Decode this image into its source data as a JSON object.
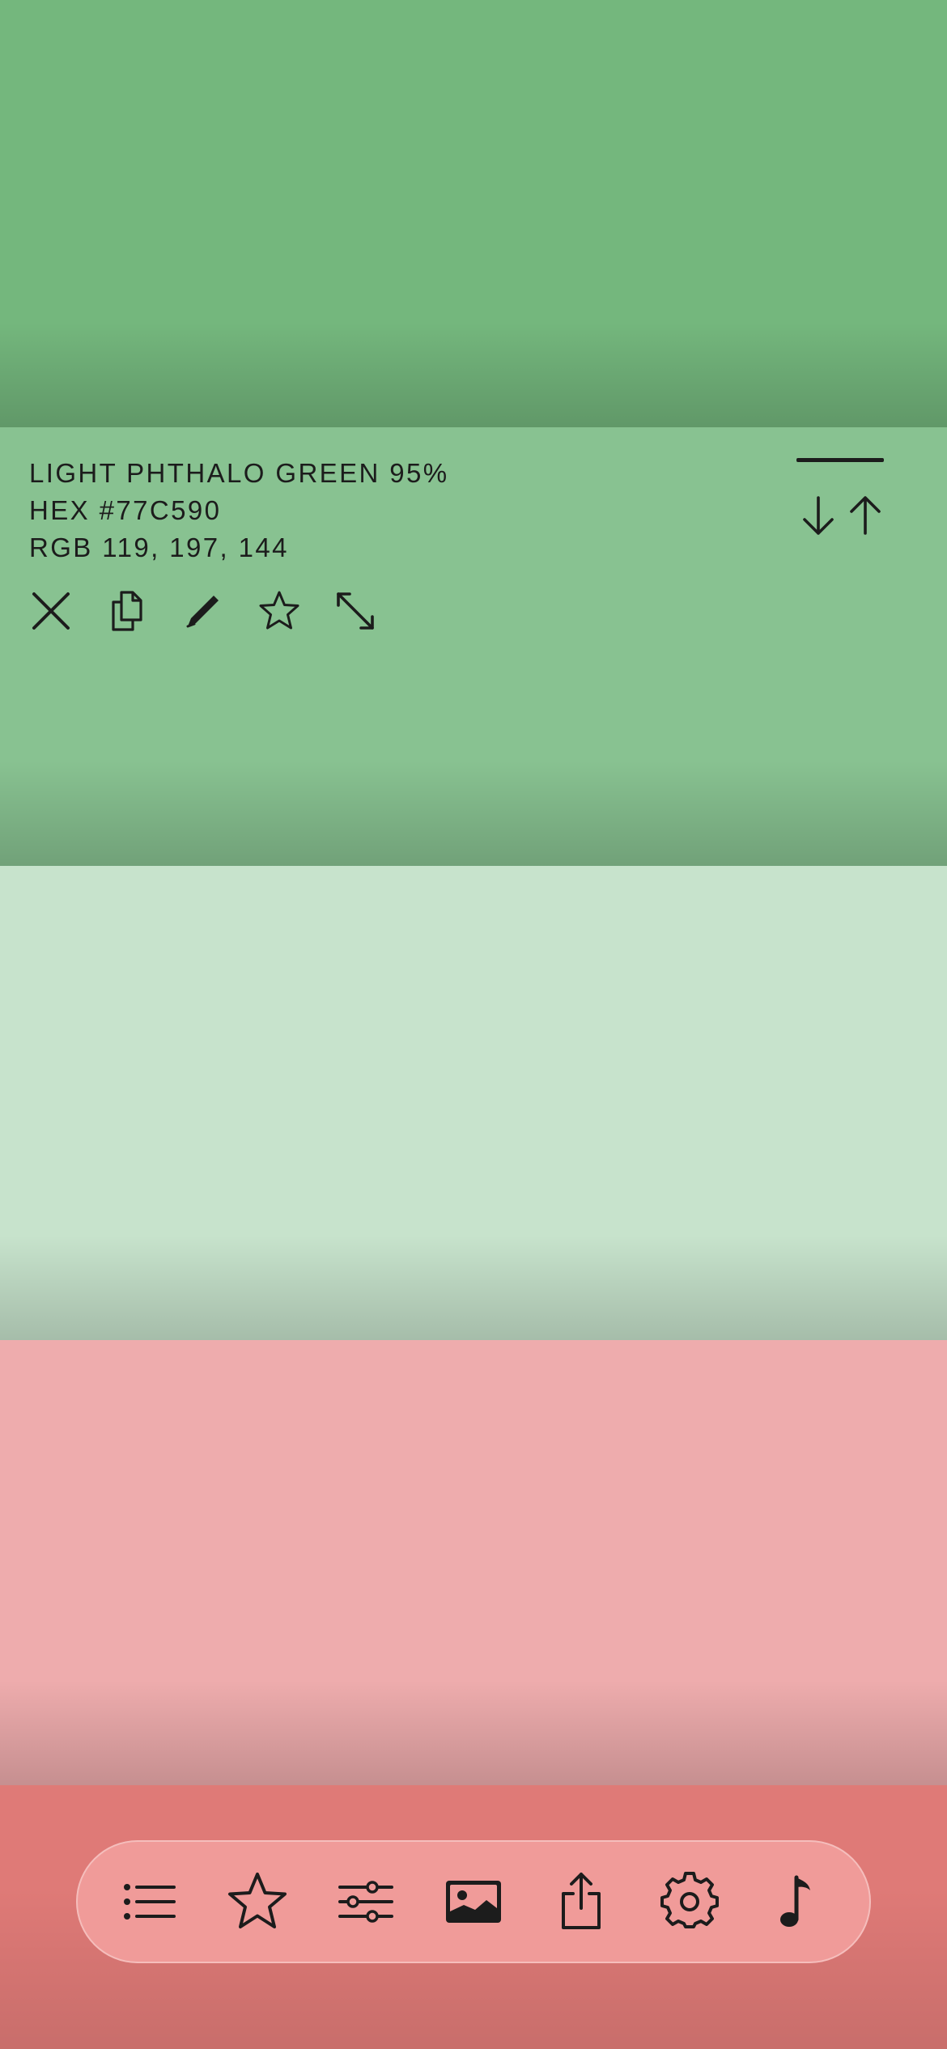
{
  "swatches": [
    {
      "color": "#74B77D"
    },
    {
      "color": "#88C291"
    },
    {
      "color": "#C7E3CC"
    },
    {
      "color": "#EEACAD"
    },
    {
      "color": "#DF7A77"
    }
  ],
  "selected": {
    "name_line": "LIGHT PHTHALO GREEN 95%",
    "hex_line": "HEX #77C590",
    "rgb_line": "RGB 119, 197, 144"
  },
  "actions": [
    {
      "icon": "close-icon"
    },
    {
      "icon": "copy-icon"
    },
    {
      "icon": "pencil-icon"
    },
    {
      "icon": "star-icon"
    },
    {
      "icon": "expand-icon"
    }
  ],
  "sort_controls": [
    {
      "icon": "arrow-down-icon"
    },
    {
      "icon": "arrow-up-icon"
    }
  ],
  "tabbar": {
    "items": [
      {
        "icon": "list-icon"
      },
      {
        "icon": "star-icon"
      },
      {
        "icon": "sliders-icon"
      },
      {
        "icon": "image-icon"
      },
      {
        "icon": "share-icon"
      },
      {
        "icon": "gear-icon"
      },
      {
        "icon": "music-note-icon"
      }
    ]
  },
  "colors": {
    "text": "#1C1C1C",
    "tabbar_bg": "#F09B99"
  }
}
